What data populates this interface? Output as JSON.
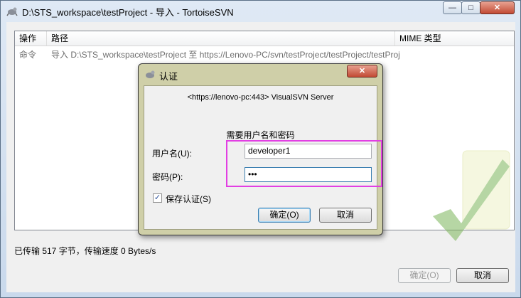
{
  "window": {
    "title": "D:\\STS_workspace\\testProject - 导入 - TortoiseSVN",
    "controls": {
      "minimize": "—",
      "maximize": "□",
      "close": "✕"
    }
  },
  "list": {
    "columns": [
      "操作",
      "路径",
      "MIME 类型"
    ],
    "rows": [
      {
        "action": "命令",
        "path": "导入 D:\\STS_workspace\\testProject 至 https://Lenovo-PC/svn/testProject/testProject/testProject",
        "mime": ""
      }
    ]
  },
  "status": "已传输 517 字节，传输速度 0 Bytes/s",
  "buttons": {
    "ok": "确定(O)",
    "cancel": "取消"
  },
  "auth_dialog": {
    "title": "认证",
    "close": "✕",
    "server": "<https://lenovo-pc:443> VisualSVN Server",
    "prompt": "需要用户名和密码",
    "username_label": "用户名(U):",
    "username_value": "developer1",
    "password_label": "密码(P):",
    "password_value": "•••",
    "save_label": "保存认证(S)",
    "save_checked": true,
    "ok_label": "确定(O)",
    "cancel_label": "取消"
  },
  "colors": {
    "highlight": "#e23fe3",
    "logo": "#7cb65a"
  }
}
